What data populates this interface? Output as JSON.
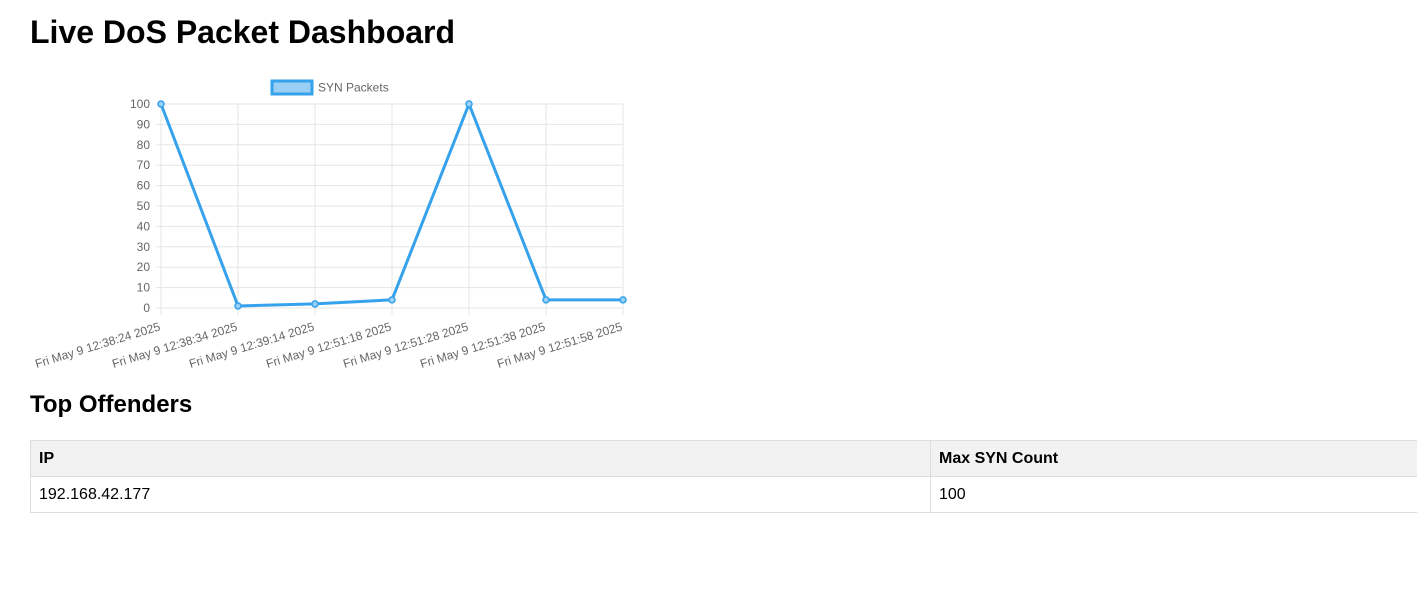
{
  "page": {
    "title": "Live DoS Packet Dashboard",
    "offenders_heading": "Top Offenders"
  },
  "colors": {
    "series_line": "#36a2eb",
    "series_fill": "#9ad0f5",
    "grid": "#e5e5e5",
    "tick_text": "#666666"
  },
  "chart_data": {
    "type": "line",
    "x": [
      "Fri May  9 12:38:24 2025",
      "Fri May  9 12:38:34 2025",
      "Fri May  9 12:39:14 2025",
      "Fri May  9 12:51:18 2025",
      "Fri May  9 12:51:28 2025",
      "Fri May  9 12:51:38 2025",
      "Fri May  9 12:51:58 2025"
    ],
    "series": [
      {
        "name": "SYN Packets",
        "values": [
          100,
          1,
          2,
          4,
          100,
          4,
          4
        ]
      }
    ],
    "ylim": [
      0,
      100
    ],
    "yticks": [
      0,
      10,
      20,
      30,
      40,
      50,
      60,
      70,
      80,
      90,
      100
    ],
    "grid": true,
    "legend": "top"
  },
  "table": {
    "headers": [
      "IP",
      "Max SYN Count"
    ],
    "rows": [
      [
        "192.168.42.177",
        "100"
      ]
    ]
  }
}
